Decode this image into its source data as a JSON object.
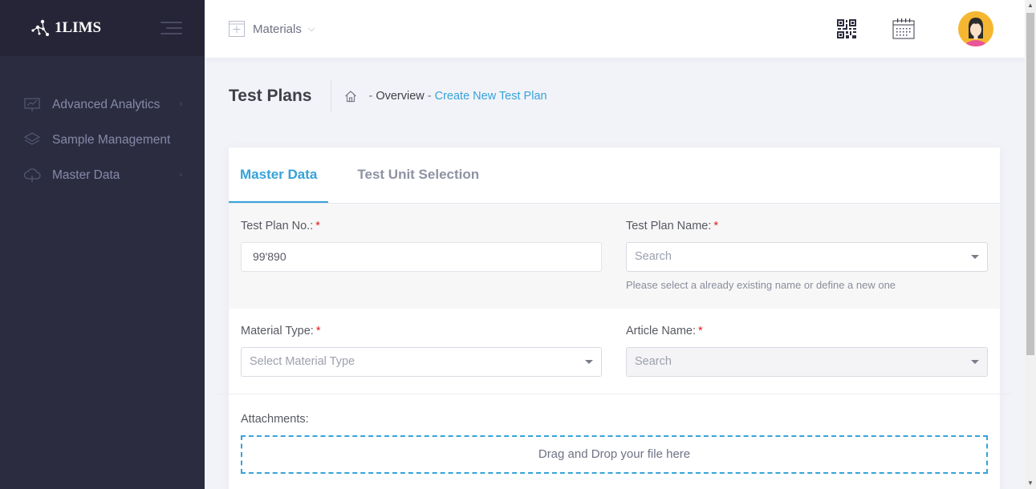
{
  "brand": {
    "name": "1LIMS"
  },
  "sidebar": {
    "items": [
      {
        "label": "Advanced Analytics",
        "icon": "chart-presentation-icon",
        "has_submenu": true
      },
      {
        "label": "Sample Management",
        "icon": "layers-icon",
        "has_submenu": false
      },
      {
        "label": "Master Data",
        "icon": "cloud-icon",
        "has_submenu": true
      }
    ]
  },
  "topbar": {
    "module_label": "Materials",
    "qr_icon": "qr-code-icon",
    "calendar_icon": "calendar-icon",
    "avatar_icon": "user-avatar-icon"
  },
  "header": {
    "title": "Test Plans",
    "breadcrumb": {
      "sep": "-",
      "overview": "Overview",
      "current": "Create New Test Plan"
    }
  },
  "tabs": [
    {
      "label": "Master Data",
      "active": true
    },
    {
      "label": "Test Unit Selection",
      "active": false
    }
  ],
  "form": {
    "test_plan_no": {
      "label": "Test Plan No.:",
      "required": "*",
      "value": "99'890"
    },
    "test_plan_name": {
      "label": "Test Plan Name:",
      "required": "*",
      "placeholder": "Search",
      "hint": "Please select a already existing name or define a new one"
    },
    "material_type": {
      "label": "Material Type:",
      "required": "*",
      "placeholder": "Select Material Type"
    },
    "article_name": {
      "label": "Article Name:",
      "required": "*",
      "placeholder": "Search",
      "disabled": true
    },
    "attachments": {
      "label": "Attachments:",
      "dropzone_text": "Drag and Drop your file here"
    }
  },
  "colors": {
    "accent": "#36a3d9",
    "sidebar_bg": "#2c2c40",
    "required": "#e31b1b"
  }
}
